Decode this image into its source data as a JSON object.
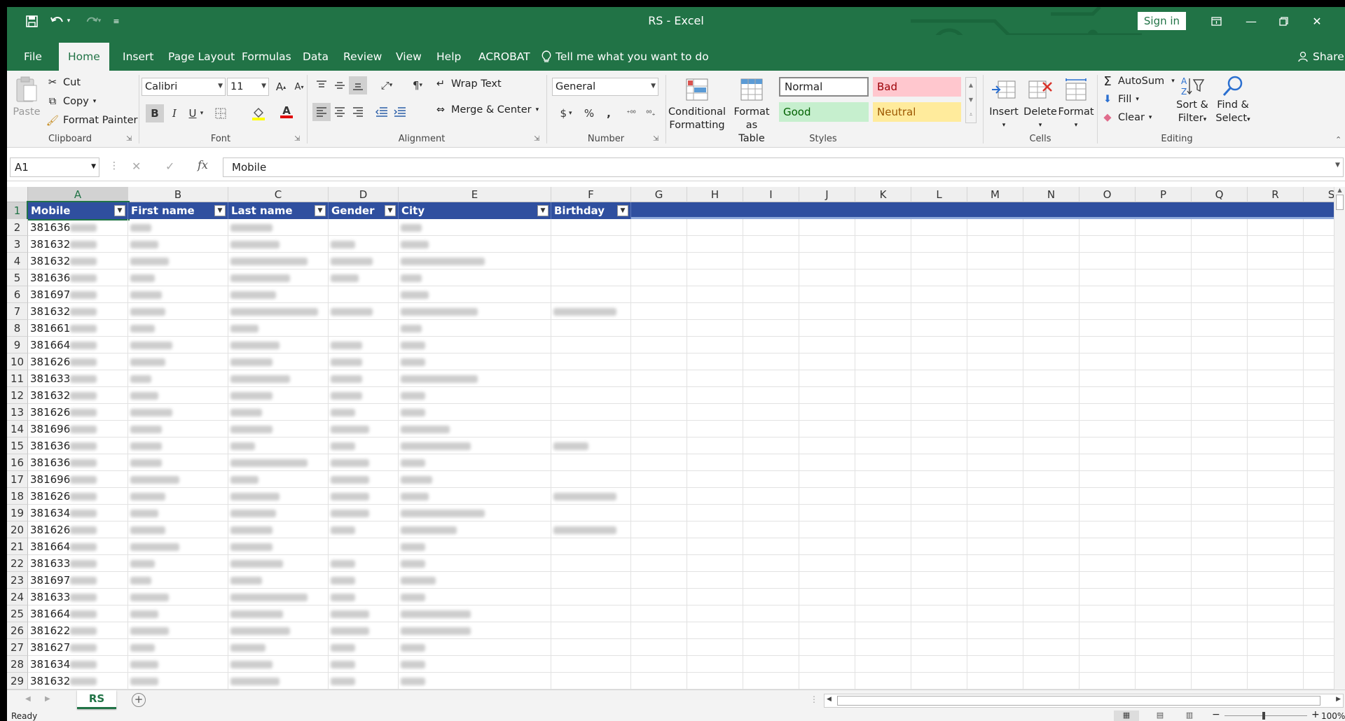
{
  "window": {
    "title": "RS  -  Excel",
    "sign_in": "Sign in",
    "share": "Share"
  },
  "menu": {
    "tabs": [
      "File",
      "Home",
      "Insert",
      "Page Layout",
      "Formulas",
      "Data",
      "Review",
      "View",
      "Help",
      "ACROBAT"
    ],
    "active": "Home",
    "tell_me": "Tell me what you want to do"
  },
  "ribbon": {
    "clipboard": {
      "paste": "Paste",
      "cut": "Cut",
      "copy": "Copy",
      "format_painter": "Format Painter",
      "label": "Clipboard"
    },
    "font": {
      "name": "Calibri",
      "size": "11",
      "bold": "B",
      "italic": "I",
      "underline": "U",
      "label": "Font"
    },
    "alignment": {
      "wrap": "Wrap Text",
      "merge": "Merge & Center",
      "label": "Alignment"
    },
    "number": {
      "format": "General",
      "currency": "$",
      "percent": "%",
      "comma": ",",
      "label": "Number"
    },
    "styles": {
      "conditional": "Conditional",
      "conditional2": "Formatting",
      "format_as": "Format as",
      "format_as2": "Table",
      "normal": "Normal",
      "bad": "Bad",
      "good": "Good",
      "neutral": "Neutral",
      "label": "Styles"
    },
    "cells": {
      "insert": "Insert",
      "delete": "Delete",
      "format": "Format",
      "label": "Cells"
    },
    "editing": {
      "autosum": "AutoSum",
      "fill": "Fill",
      "clear": "Clear",
      "sort": "Sort &",
      "sort2": "Filter",
      "find": "Find &",
      "find2": "Select",
      "label": "Editing"
    }
  },
  "formula_bar": {
    "name_box": "A1",
    "fx": "fx",
    "content": "Mobile"
  },
  "sheet": {
    "columns": [
      "A",
      "B",
      "C",
      "D",
      "E",
      "F",
      "G",
      "H",
      "I",
      "J",
      "K",
      "L",
      "M",
      "N",
      "O",
      "P",
      "Q",
      "R",
      "S"
    ],
    "headers": [
      "Mobile",
      "First name",
      "Last name",
      "Gender",
      "City",
      "Birthday"
    ],
    "rows": [
      "1",
      "2",
      "3",
      "4",
      "5",
      "6",
      "7",
      "8",
      "9",
      "10",
      "11",
      "12",
      "13",
      "14",
      "15",
      "16",
      "17",
      "18",
      "19",
      "20",
      "21",
      "22",
      "23",
      "24",
      "25",
      "26",
      "27",
      "28",
      "29"
    ],
    "mobiles": [
      "381636",
      "381632",
      "381632",
      "381636",
      "381697",
      "381632",
      "381661",
      "381664",
      "381626",
      "381633",
      "381632",
      "381626",
      "381696",
      "381636",
      "381636",
      "381696",
      "381626",
      "381634",
      "381626",
      "381664",
      "381633",
      "381697",
      "381633",
      "381664",
      "381622",
      "381627",
      "381634",
      "381632"
    ]
  },
  "tabs_bar": {
    "sheet": "RS"
  },
  "status": {
    "ready": "Ready",
    "zoom": "100%"
  },
  "colors": {
    "accent": "#217346",
    "table_header": "#2f4f9f"
  }
}
